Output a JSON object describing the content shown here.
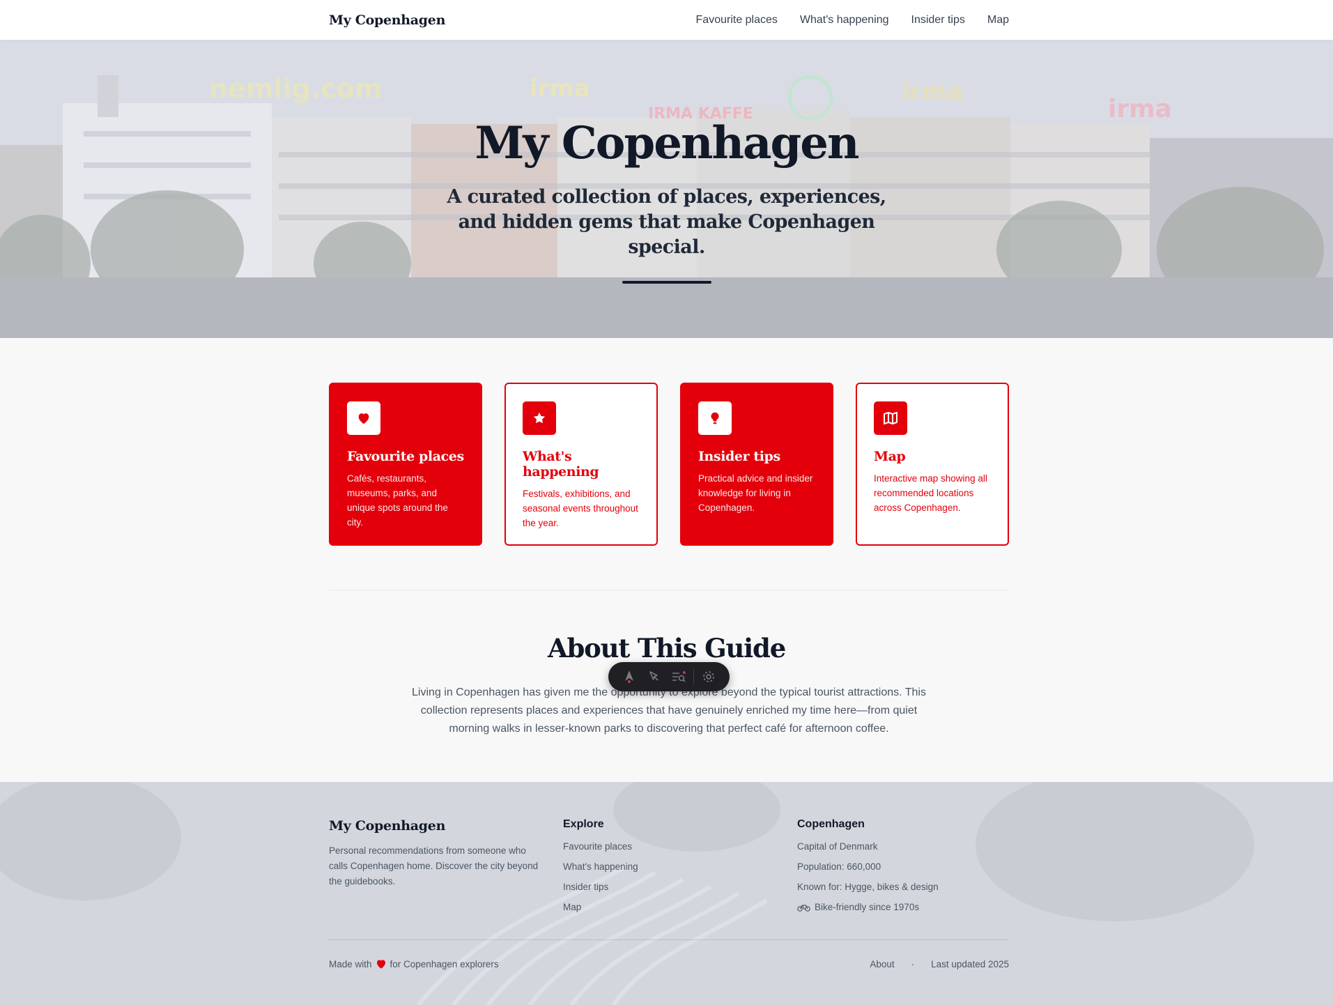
{
  "nav": {
    "brand": "My Copenhagen",
    "links": [
      "Favourite places",
      "What's happening",
      "Insider tips",
      "Map"
    ]
  },
  "hero": {
    "title": "My Copenhagen",
    "subtitle": "A curated collection of places, experiences, and hidden gems that make Copenhagen special."
  },
  "cards": [
    {
      "title": "Favourite places",
      "desc": "Cafés, restaurants, museums, parks, and unique spots around the city.",
      "style": "filled",
      "icon": "heart-icon"
    },
    {
      "title": "What's happening",
      "desc": "Festivals, exhibitions, and seasonal events throughout the year.",
      "style": "outline",
      "icon": "star-icon"
    },
    {
      "title": "Insider tips",
      "desc": "Practical advice and insider knowledge for living in Copenhagen.",
      "style": "filled",
      "icon": "lightbulb-icon"
    },
    {
      "title": "Map",
      "desc": "Interactive map showing all recommended locations across Copenhagen.",
      "style": "outline",
      "icon": "map-icon"
    }
  ],
  "about": {
    "title": "About This Guide",
    "text": "Living in Copenhagen has given me the opportunity to explore beyond the typical tourist attractions. This collection represents places and experiences that have genuinely enriched my time here—from quiet morning walks in lesser-known parks to discovering that perfect café for afternoon coffee."
  },
  "footer": {
    "brand": "My Copenhagen",
    "desc": "Personal recommendations from someone who calls Copenhagen home. Discover the city beyond the guidebooks.",
    "explore_heading": "Explore",
    "explore_links": [
      "Favourite places",
      "What's happening",
      "Insider tips",
      "Map"
    ],
    "city_heading": "Copenhagen",
    "city_facts": [
      "Capital of Denmark",
      "Population: 660,000",
      "Known for: Hygge, bikes & design",
      "Bike-friendly since 1970s"
    ],
    "made_with_prefix": "Made with",
    "made_with_suffix": "for Copenhagen explorers",
    "about_link": "About",
    "separator": "·",
    "last_updated": "Last updated 2025"
  },
  "colors": {
    "accent": "#e3000b",
    "text_dark": "#111827",
    "text_muted": "#4b5563"
  }
}
